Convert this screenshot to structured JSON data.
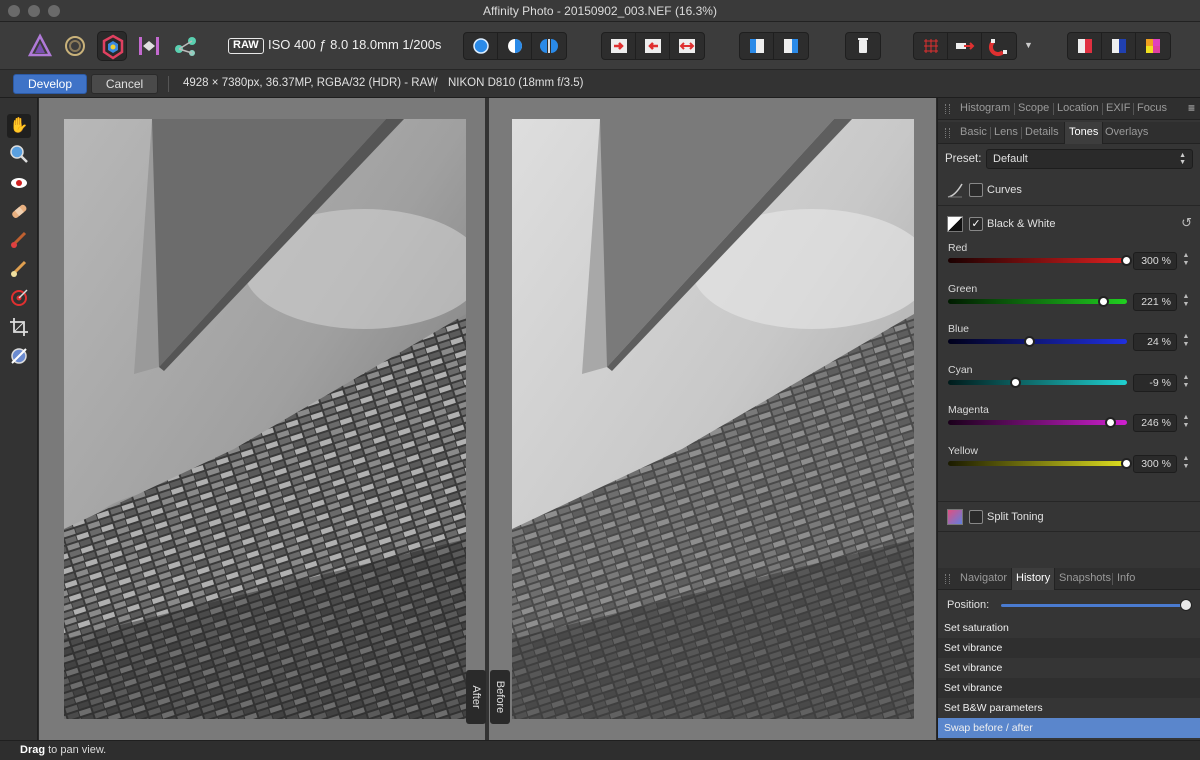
{
  "window": {
    "title": "Affinity Photo - 20150902_003.NEF (16.3%)"
  },
  "toolbar": {
    "personas": [
      {
        "name": "photo-persona-icon"
      },
      {
        "name": "liquify-persona-icon"
      },
      {
        "name": "develop-persona-icon",
        "active": true
      },
      {
        "name": "tone-mapping-persona-icon"
      },
      {
        "name": "export-persona-icon"
      }
    ],
    "raw_badge": "RAW",
    "exif": "ISO 400 ƒ 8.0 18.0mm 1/200s"
  },
  "context": {
    "develop_label": "Develop",
    "cancel_label": "Cancel",
    "image_info": "4928 × 7380px, 36.37MP, RGBA/32 (HDR) - RAW",
    "camera": "NIKON D810 (18mm f/3.5)"
  },
  "canvas": {
    "after_label": "After",
    "before_label": "Before"
  },
  "panel": {
    "top_tabs": [
      "Histogram",
      "Scope",
      "Location",
      "EXIF",
      "Focus"
    ],
    "adjust_tabs": [
      "Basic",
      "Lens",
      "Details",
      "Tones",
      "Overlays"
    ],
    "adjust_selected": "Tones",
    "preset_label": "Preset:",
    "preset_value": "Default",
    "curves_label": "Curves",
    "bw_label": "Black & White",
    "bw_checked": "✓",
    "split_toning_label": "Split Toning",
    "sliders": [
      {
        "name": "Red",
        "value": "300 %",
        "level": 1.0,
        "gradient": "linear-gradient(to right,#1a0000,#e02020)"
      },
      {
        "name": "Green",
        "value": "221 %",
        "level": 0.87,
        "gradient": "linear-gradient(to right,#001a00,#20d020)"
      },
      {
        "name": "Blue",
        "value": "24 %",
        "level": 0.46,
        "gradient": "linear-gradient(to right,#00001a,#2030e0)"
      },
      {
        "name": "Cyan",
        "value": "-9 %",
        "level": 0.38,
        "gradient": "linear-gradient(to right,#001a1a,#20d0d0)"
      },
      {
        "name": "Magenta",
        "value": "246 %",
        "level": 0.91,
        "gradient": "linear-gradient(to right,#1a001a,#d020d0)"
      },
      {
        "name": "Yellow",
        "value": "300 %",
        "level": 1.0,
        "gradient": "linear-gradient(to right,#1a1a00,#e0e020)"
      }
    ],
    "bottom_tabs": [
      "Navigator",
      "History",
      "Snapshots",
      "Info"
    ],
    "bottom_selected": "History",
    "position_label": "Position:",
    "history": [
      {
        "label": "Set saturation"
      },
      {
        "label": "Set vibrance"
      },
      {
        "label": "Set vibrance"
      },
      {
        "label": "Set vibrance"
      },
      {
        "label": "Set B&W parameters"
      },
      {
        "label": "Swap before / after",
        "selected": true
      }
    ]
  },
  "status": {
    "bold": "Drag",
    "text": " to pan view."
  }
}
